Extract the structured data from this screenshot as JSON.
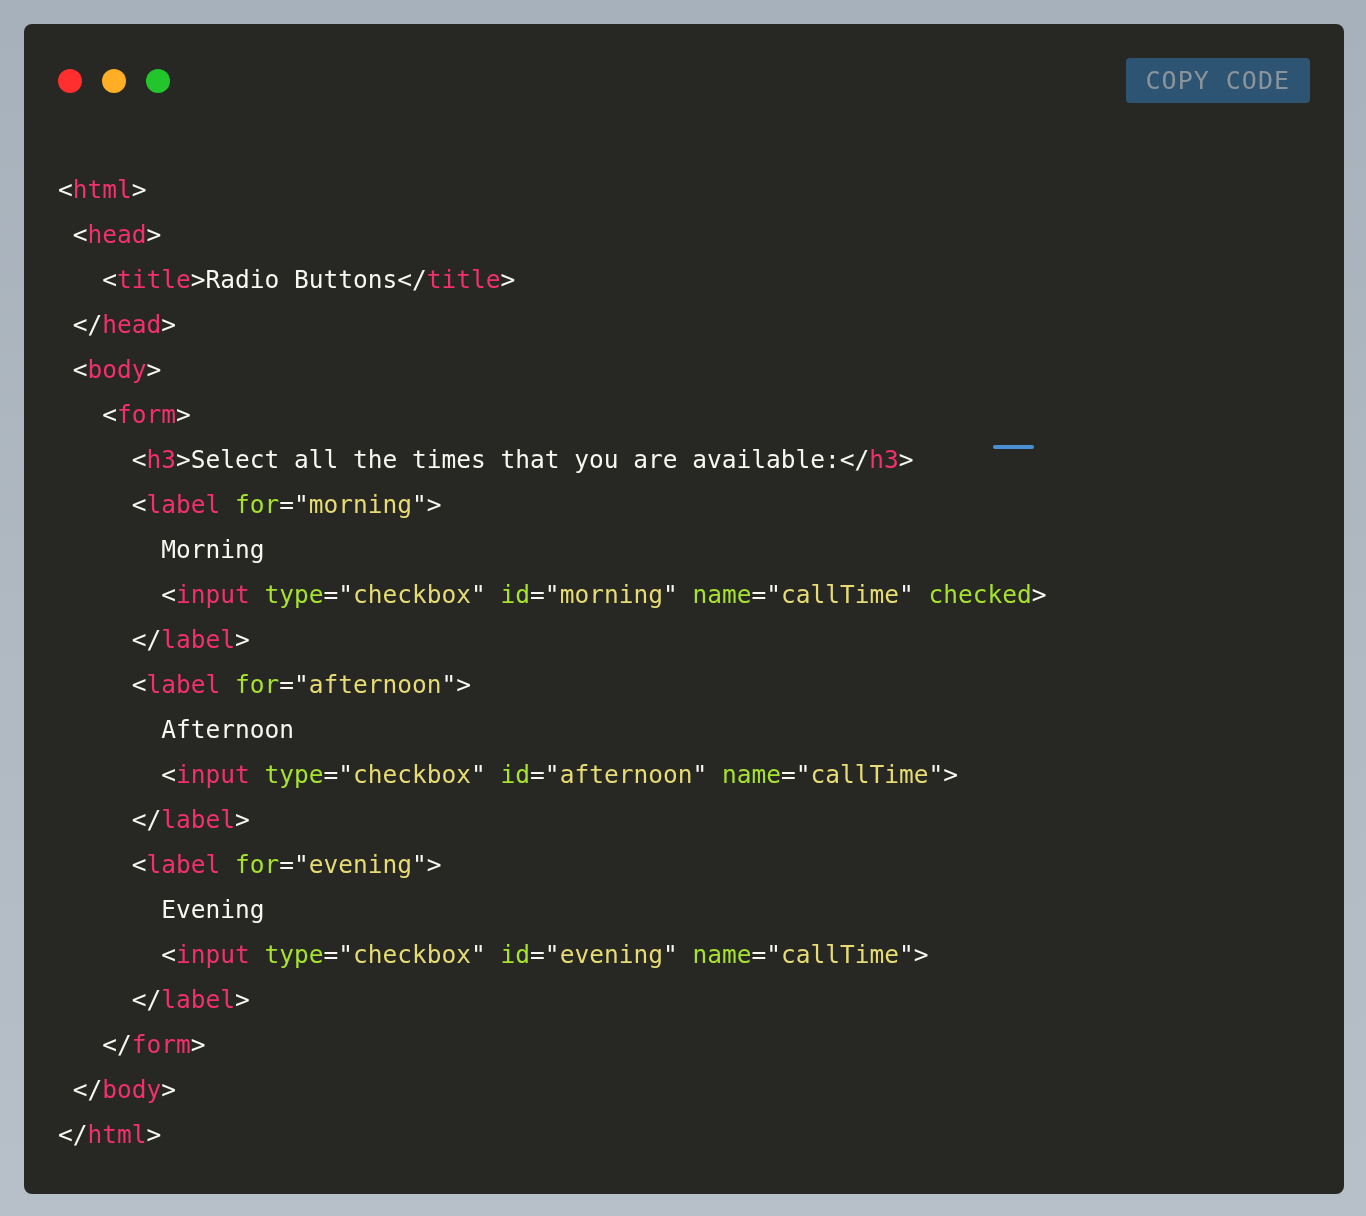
{
  "window": {
    "controls": [
      {
        "color": "#ff2f2f"
      },
      {
        "color": "#ffae25"
      },
      {
        "color": "#22c52b"
      }
    ]
  },
  "copy_button": {
    "label": "COPY CODE"
  },
  "code_lines": [
    [
      {
        "kind": "punct",
        "text": "<"
      },
      {
        "kind": "tag",
        "text": "html"
      },
      {
        "kind": "punct",
        "text": ">"
      }
    ],
    [
      {
        "kind": "punct",
        "text": " <"
      },
      {
        "kind": "tag",
        "text": "head"
      },
      {
        "kind": "punct",
        "text": ">"
      }
    ],
    [
      {
        "kind": "punct",
        "text": "   <"
      },
      {
        "kind": "tag",
        "text": "title"
      },
      {
        "kind": "punct",
        "text": ">Radio Buttons</"
      },
      {
        "kind": "tag",
        "text": "title"
      },
      {
        "kind": "punct",
        "text": ">"
      }
    ],
    [
      {
        "kind": "punct",
        "text": " </"
      },
      {
        "kind": "tag",
        "text": "head"
      },
      {
        "kind": "punct",
        "text": ">"
      }
    ],
    [
      {
        "kind": "punct",
        "text": " <"
      },
      {
        "kind": "tag",
        "text": "body"
      },
      {
        "kind": "punct",
        "text": ">"
      }
    ],
    [
      {
        "kind": "punct",
        "text": "   <"
      },
      {
        "kind": "tag",
        "text": "form"
      },
      {
        "kind": "punct",
        "text": ">"
      }
    ],
    [
      {
        "kind": "punct",
        "text": "     <"
      },
      {
        "kind": "tag",
        "text": "h3"
      },
      {
        "kind": "punct",
        "text": ">Select all the times that you are available:</"
      },
      {
        "kind": "tag",
        "text": "h3"
      },
      {
        "kind": "punct",
        "text": ">"
      }
    ],
    [
      {
        "kind": "punct",
        "text": "     <"
      },
      {
        "kind": "tag",
        "text": "label"
      },
      {
        "kind": "attr",
        "text": " for"
      },
      {
        "kind": "punct",
        "text": "=\""
      },
      {
        "kind": "string",
        "text": "morning"
      },
      {
        "kind": "punct",
        "text": "\">"
      }
    ],
    [
      {
        "kind": "punct",
        "text": "       Morning"
      }
    ],
    [
      {
        "kind": "punct",
        "text": "       <"
      },
      {
        "kind": "tag",
        "text": "input"
      },
      {
        "kind": "attr",
        "text": " type"
      },
      {
        "kind": "punct",
        "text": "=\""
      },
      {
        "kind": "string",
        "text": "checkbox"
      },
      {
        "kind": "punct",
        "text": "\" "
      },
      {
        "kind": "attr",
        "text": "id"
      },
      {
        "kind": "punct",
        "text": "=\""
      },
      {
        "kind": "string",
        "text": "morning"
      },
      {
        "kind": "punct",
        "text": "\" "
      },
      {
        "kind": "attr",
        "text": "name"
      },
      {
        "kind": "punct",
        "text": "=\""
      },
      {
        "kind": "string",
        "text": "callTime"
      },
      {
        "kind": "punct",
        "text": "\" "
      },
      {
        "kind": "attr",
        "text": "checked"
      },
      {
        "kind": "punct",
        "text": ">"
      }
    ],
    [
      {
        "kind": "punct",
        "text": "     </"
      },
      {
        "kind": "tag",
        "text": "label"
      },
      {
        "kind": "punct",
        "text": ">"
      }
    ],
    [
      {
        "kind": "punct",
        "text": "     <"
      },
      {
        "kind": "tag",
        "text": "label"
      },
      {
        "kind": "attr",
        "text": " for"
      },
      {
        "kind": "punct",
        "text": "=\""
      },
      {
        "kind": "string",
        "text": "afternoon"
      },
      {
        "kind": "punct",
        "text": "\">"
      }
    ],
    [
      {
        "kind": "punct",
        "text": "       Afternoon"
      }
    ],
    [
      {
        "kind": "punct",
        "text": "       <"
      },
      {
        "kind": "tag",
        "text": "input"
      },
      {
        "kind": "attr",
        "text": " type"
      },
      {
        "kind": "punct",
        "text": "=\""
      },
      {
        "kind": "string",
        "text": "checkbox"
      },
      {
        "kind": "punct",
        "text": "\" "
      },
      {
        "kind": "attr",
        "text": "id"
      },
      {
        "kind": "punct",
        "text": "=\""
      },
      {
        "kind": "string",
        "text": "afternoon"
      },
      {
        "kind": "punct",
        "text": "\" "
      },
      {
        "kind": "attr",
        "text": "name"
      },
      {
        "kind": "punct",
        "text": "=\""
      },
      {
        "kind": "string",
        "text": "callTime"
      },
      {
        "kind": "punct",
        "text": "\">"
      }
    ],
    [
      {
        "kind": "punct",
        "text": "     </"
      },
      {
        "kind": "tag",
        "text": "label"
      },
      {
        "kind": "punct",
        "text": ">"
      }
    ],
    [
      {
        "kind": "punct",
        "text": "     <"
      },
      {
        "kind": "tag",
        "text": "label"
      },
      {
        "kind": "attr",
        "text": " for"
      },
      {
        "kind": "punct",
        "text": "=\""
      },
      {
        "kind": "string",
        "text": "evening"
      },
      {
        "kind": "punct",
        "text": "\">"
      }
    ],
    [
      {
        "kind": "punct",
        "text": "       Evening"
      }
    ],
    [
      {
        "kind": "punct",
        "text": "       <"
      },
      {
        "kind": "tag",
        "text": "input"
      },
      {
        "kind": "attr",
        "text": " type"
      },
      {
        "kind": "punct",
        "text": "=\""
      },
      {
        "kind": "string",
        "text": "checkbox"
      },
      {
        "kind": "punct",
        "text": "\" "
      },
      {
        "kind": "attr",
        "text": "id"
      },
      {
        "kind": "punct",
        "text": "=\""
      },
      {
        "kind": "string",
        "text": "evening"
      },
      {
        "kind": "punct",
        "text": "\" "
      },
      {
        "kind": "attr",
        "text": "name"
      },
      {
        "kind": "punct",
        "text": "=\""
      },
      {
        "kind": "string",
        "text": "callTime"
      },
      {
        "kind": "punct",
        "text": "\">"
      }
    ],
    [
      {
        "kind": "punct",
        "text": "     </"
      },
      {
        "kind": "tag",
        "text": "label"
      },
      {
        "kind": "punct",
        "text": ">"
      }
    ],
    [
      {
        "kind": "punct",
        "text": "   </"
      },
      {
        "kind": "tag",
        "text": "form"
      },
      {
        "kind": "punct",
        "text": ">"
      }
    ],
    [
      {
        "kind": "punct",
        "text": " </"
      },
      {
        "kind": "tag",
        "text": "body"
      },
      {
        "kind": "punct",
        "text": ">"
      }
    ],
    [
      {
        "kind": "punct",
        "text": "</"
      },
      {
        "kind": "tag",
        "text": "html"
      },
      {
        "kind": "punct",
        "text": ">"
      }
    ]
  ]
}
